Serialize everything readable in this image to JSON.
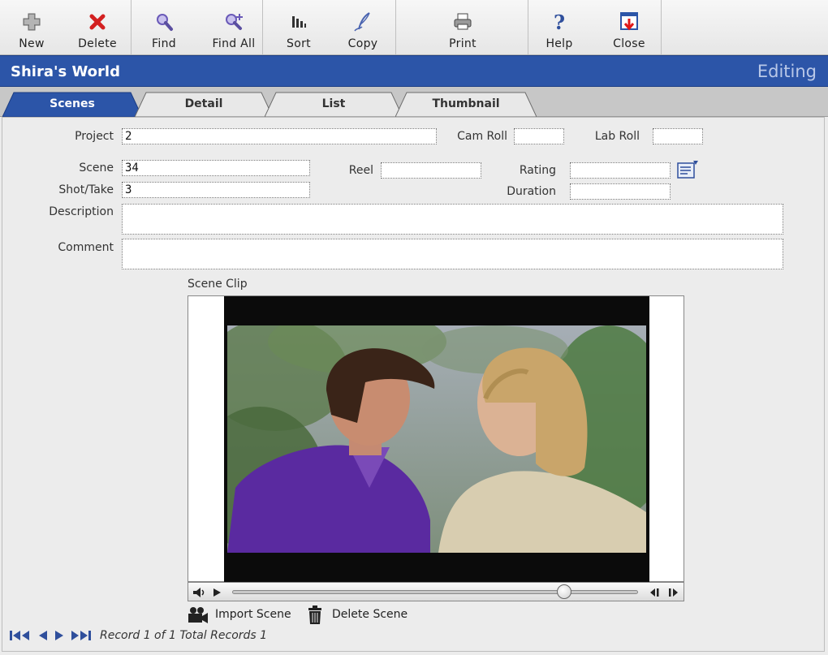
{
  "toolbar": {
    "new_label": "New",
    "delete_label": "Delete",
    "find_label": "Find",
    "find_all_label": "Find All",
    "sort_label": "Sort",
    "copy_label": "Copy",
    "print_label": "Print",
    "help_label": "Help",
    "close_label": "Close"
  },
  "header": {
    "title": "Shira's World",
    "mode": "Editing"
  },
  "tabs": [
    {
      "label": "Scenes",
      "active": true
    },
    {
      "label": "Detail",
      "active": false
    },
    {
      "label": "List",
      "active": false
    },
    {
      "label": "Thumbnail",
      "active": false
    }
  ],
  "form": {
    "project_label": "Project",
    "project_value": "2",
    "cam_roll_label": "Cam Roll",
    "cam_roll_value": "",
    "lab_roll_label": "Lab Roll",
    "lab_roll_value": "",
    "scene_label": "Scene",
    "scene_value": "34",
    "reel_label": "Reel",
    "reel_value": "",
    "rating_label": "Rating",
    "rating_value": "",
    "shot_take_label": "Shot/Take",
    "shot_take_value": "3",
    "duration_label": "Duration",
    "duration_value": "",
    "description_label": "Description",
    "description_value": "",
    "comment_label": "Comment",
    "comment_value": ""
  },
  "clip": {
    "label": "Scene Clip",
    "progress": 0.82
  },
  "actions": {
    "import_label": "Import Scene",
    "delete_label": "Delete Scene"
  },
  "record": {
    "text": "Record 1  of  1 Total Records 1"
  },
  "colors": {
    "header_bg": "#2c55a8",
    "active_tab": "#2c55a8",
    "mode_text": "#b9c8e8"
  }
}
